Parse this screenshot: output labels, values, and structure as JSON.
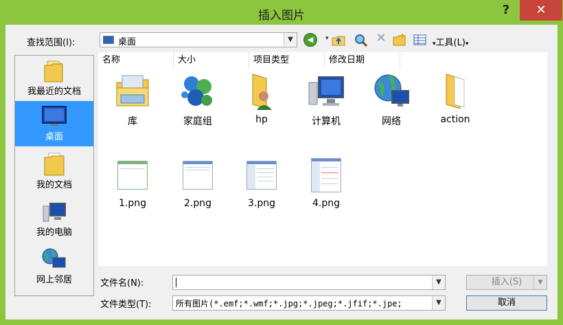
{
  "window": {
    "title": "插入图片",
    "help": "?",
    "close": "✕"
  },
  "lookin": {
    "label": "查找范围(I):",
    "value": "桌面"
  },
  "toolbar": {
    "tools_label": "工具(L)"
  },
  "places": [
    {
      "label": "我最近的文档",
      "icon": "recent-documents-icon"
    },
    {
      "label": "桌面",
      "icon": "desktop-icon",
      "selected": true
    },
    {
      "label": "我的文档",
      "icon": "my-documents-icon"
    },
    {
      "label": "我的电脑",
      "icon": "my-computer-icon"
    },
    {
      "label": "网上邻居",
      "icon": "network-places-icon"
    }
  ],
  "columns": [
    "名称",
    "大小",
    "项目类型",
    "修改日期"
  ],
  "items": [
    {
      "label": "库",
      "icon": "library-icon"
    },
    {
      "label": "家庭组",
      "icon": "homegroup-icon"
    },
    {
      "label": "hp",
      "icon": "user-folder-icon"
    },
    {
      "label": "计算机",
      "icon": "computer-icon"
    },
    {
      "label": "网络",
      "icon": "network-icon"
    },
    {
      "label": "action",
      "icon": "folder-icon"
    },
    {
      "label": "1.png",
      "icon": "image-thumbnail"
    },
    {
      "label": "2.png",
      "icon": "image-thumbnail"
    },
    {
      "label": "3.png",
      "icon": "image-thumbnail"
    },
    {
      "label": "4.png",
      "icon": "image-thumbnail"
    }
  ],
  "filename": {
    "label": "文件名(N):",
    "value": ""
  },
  "filetype": {
    "label": "文件类型(T):",
    "value": "所有图片(*.emf;*.wmf;*.jpg;*.jpeg;*.jfif;*.jpe;"
  },
  "buttons": {
    "insert": "插入(S)",
    "cancel": "取消"
  },
  "colors": {
    "accent": "#3399ff",
    "frame": "#8cc63f",
    "close": "#c7453b"
  }
}
